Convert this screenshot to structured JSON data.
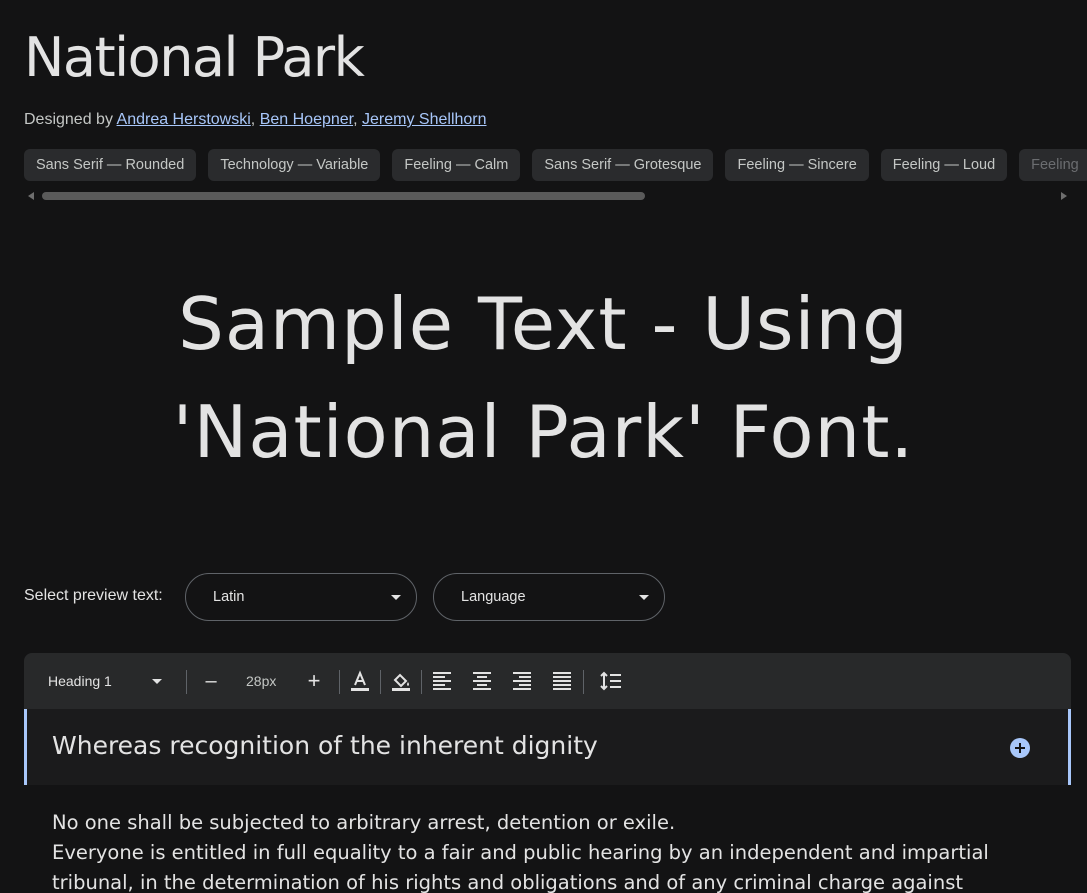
{
  "font": {
    "name": "National Park",
    "designed_by_label": "Designed by",
    "designers": [
      "Andrea Herstowski",
      "Ben Hoepner",
      "Jeremy Shellhorn"
    ],
    "separator": ","
  },
  "tags": [
    "Sans Serif — Rounded",
    "Technology — Variable",
    "Feeling — Calm",
    "Sans Serif — Grotesque",
    "Feeling — Sincere",
    "Feeling — Loud",
    "Feeling"
  ],
  "sample": {
    "line1": "Sample Text - Using",
    "line2": "'National Park' Font."
  },
  "preview": {
    "label": "Select preview text:",
    "script_value": "Latin",
    "language_value": "Language"
  },
  "toolbar": {
    "style_value": "Heading 1",
    "decrease_label": "–",
    "font_size": "28px",
    "increase_label": "+",
    "icons": [
      "text-color-icon",
      "highlight-color-icon",
      "align-left-icon",
      "align-center-icon",
      "align-right-icon",
      "align-justify-icon",
      "line-height-icon"
    ]
  },
  "editor": {
    "heading": "Whereas recognition of the inherent dignity",
    "paragraphs": [
      "No one shall be subjected to arbitrary arrest, detention or exile.",
      "Everyone is entitled in full equality to a fair and public hearing by an independent and impartial tribunal, in the determination of his rights and obligations and of any criminal charge against"
    ]
  },
  "colors": {
    "background": "#131314",
    "link": "#a8c7fa",
    "accent": "#a8c7fa",
    "chip_bg": "#2a2b2d",
    "toolbar_bg": "#28292a"
  }
}
